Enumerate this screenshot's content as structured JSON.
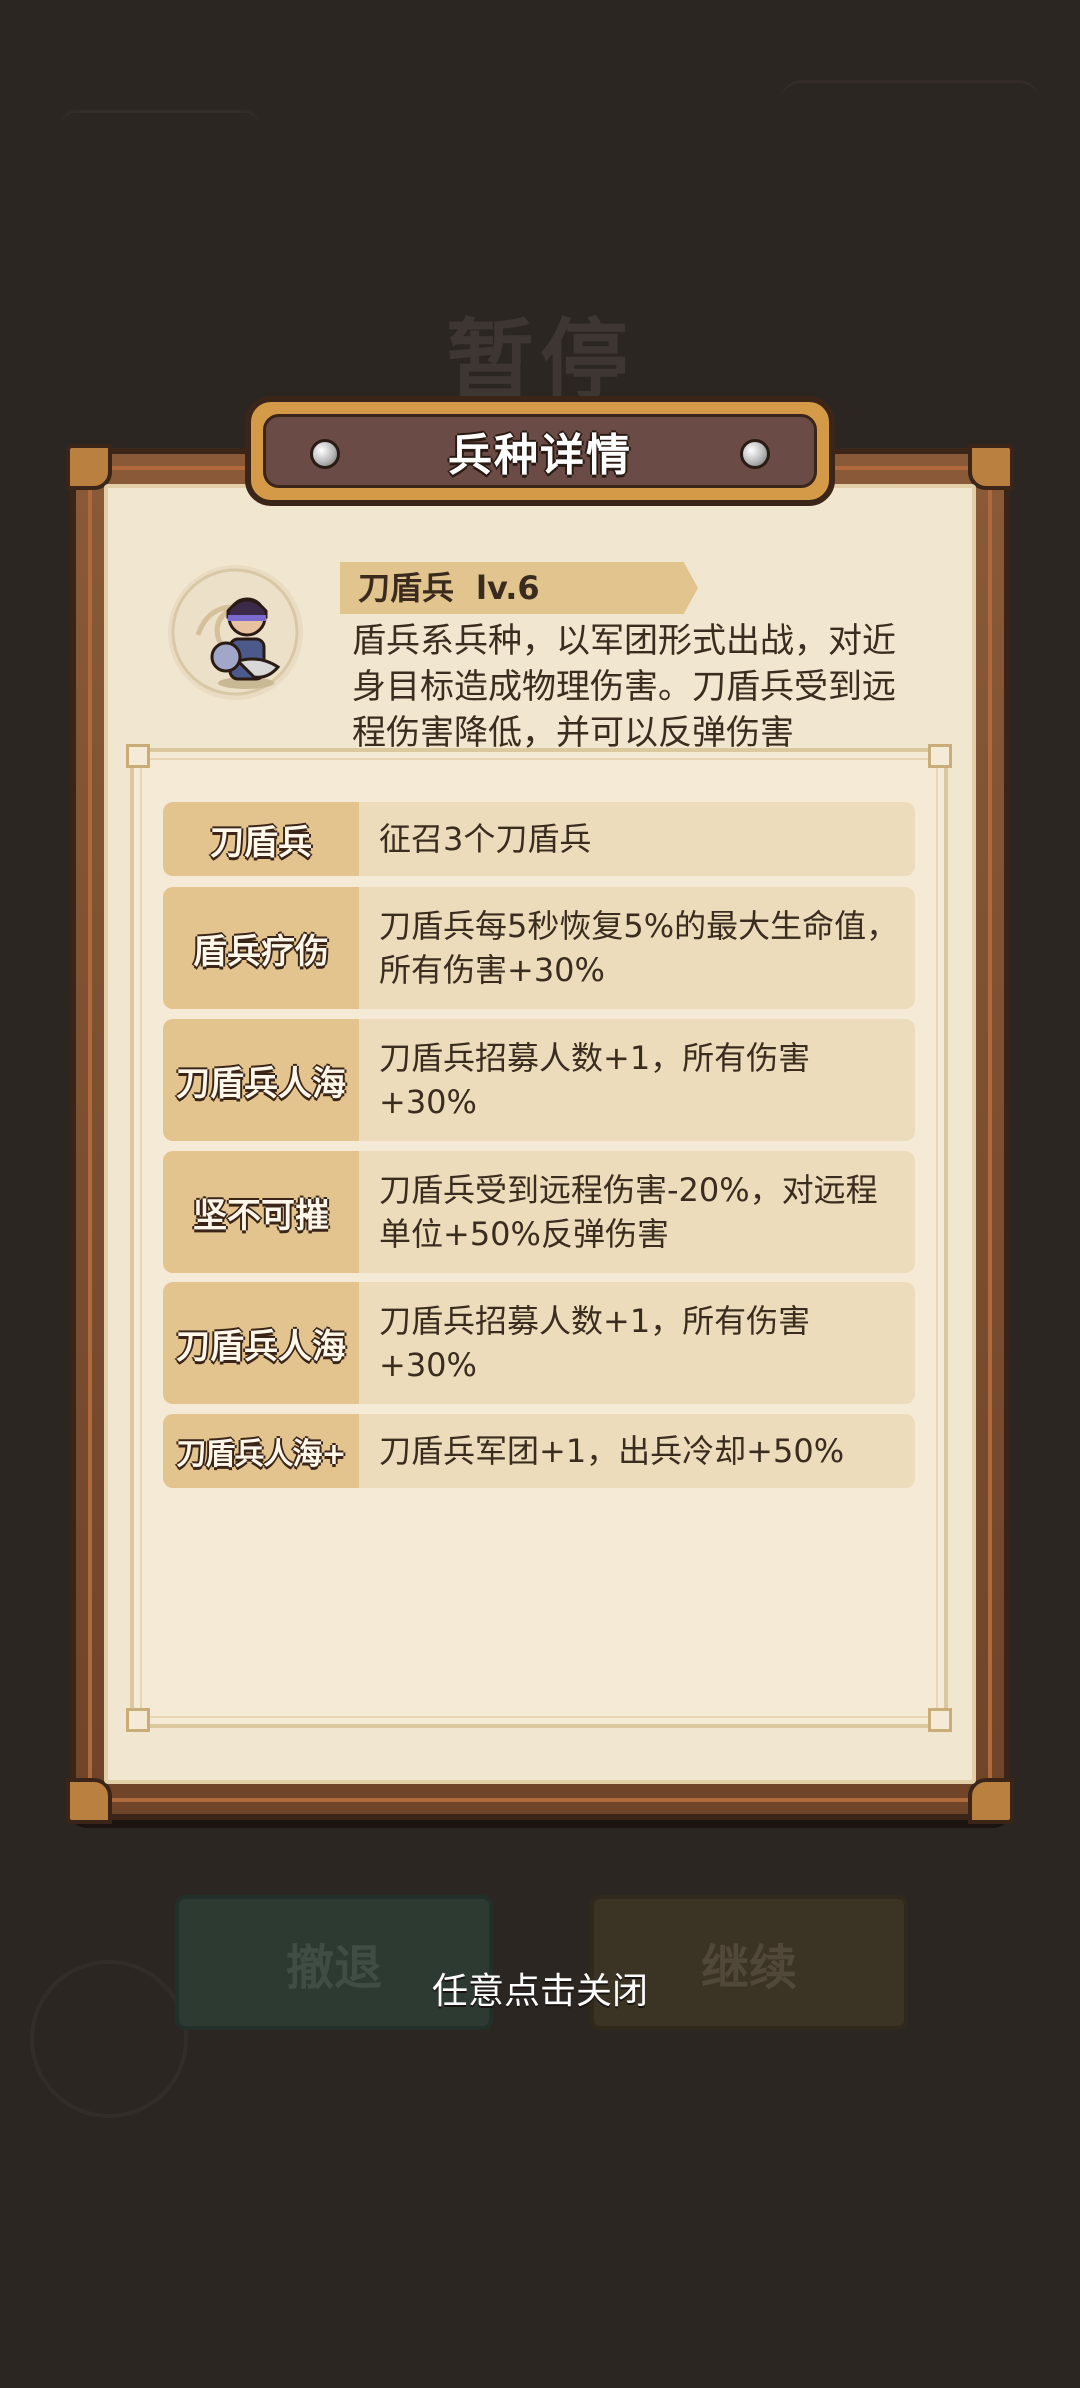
{
  "background": {
    "pause_title": "暂停",
    "retreat_button": "撤退",
    "continue_button": "继续"
  },
  "dialog": {
    "title": "兵种详情",
    "unit": {
      "name": "刀盾兵",
      "level": "lv.6",
      "description": "盾兵系兵种，以军团形式出战，对近身目标造成物理伤害。刀盾兵受到远程伤害降低，并可以反弹伤害"
    },
    "skills": [
      {
        "name": "刀盾兵",
        "desc": "征召3个刀盾兵"
      },
      {
        "name": "盾兵疗伤",
        "desc": "刀盾兵每5秒恢复5%的最大生命值，所有伤害+30%"
      },
      {
        "name": "刀盾兵人海",
        "desc": "刀盾兵招募人数+1，所有伤害+30%"
      },
      {
        "name": "坚不可摧",
        "desc": "刀盾兵受到远程伤害-20%，对远程单位+50%反弹伤害"
      },
      {
        "name": "刀盾兵人海",
        "desc": "刀盾兵招募人数+1，所有伤害+30%"
      },
      {
        "name": "刀盾兵人海+",
        "desc": "刀盾兵军团+1，出兵冷却+50%"
      }
    ]
  },
  "footer": {
    "close_hint": "任意点击关闭"
  },
  "colors": {
    "background": "#2c2623",
    "frame": "#8a5a38",
    "parchment": "#f1e6cf",
    "title_plate": "#6b4b45",
    "skill_name_bg": "#e3c48f",
    "skill_desc_bg": "#ecdcbb"
  },
  "icons": {
    "unit_portrait": "shield-soldier-icon",
    "rivets": "rivet-icon"
  }
}
